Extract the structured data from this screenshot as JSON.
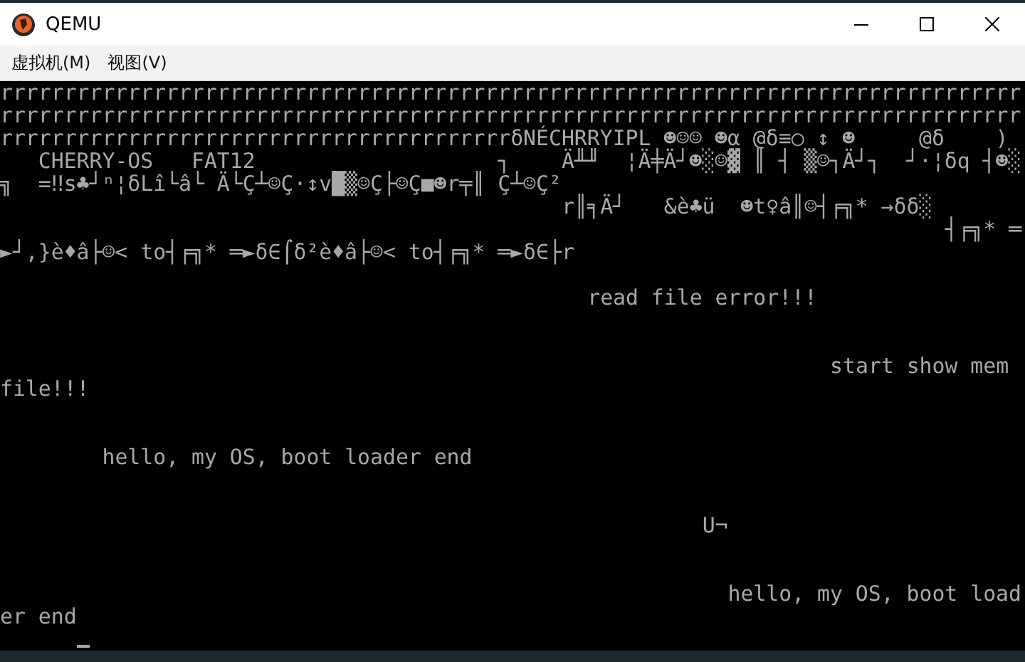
{
  "window": {
    "title": "QEMU"
  },
  "menu": [
    {
      "label": "虚拟机(M)"
    },
    {
      "label": "视图(V)"
    }
  ],
  "console": {
    "lines": [
      {
        "kind": "text",
        "text": "rrrrrrrrrrrrrrrrrrrrrrrrrrrrrrrrrrrrrrrrrrrrrrrrrrrrrrrrrrrrrrrrrrrrrrrrrrrrrrrr"
      },
      {
        "kind": "text",
        "text": "rrrrrrrrrrrrrrrrrrrrrrrrrrrrrrrrrrrrrrrrrrrrrrrrrrrrrrrrrrrrrrrrrrrrrrrrrrrrrrrr"
      },
      {
        "kind": "text",
        "text": "rrrrrrrrrrrrrrrrrrrrrrrrrrrrrrrrrrrrrrrrδNÉCHRRYIPL ☻☺☺ ☻α @δ≡○ ↕ ☻     @δ    )"
      },
      {
        "kind": "text",
        "text": "   CHERRY-OS   FAT12                   ┐    Ä╨╜  ¦Ä╪Ä┘☻░☺▓ ║ ┤ ▒☺┐Ä┘┐  ┘·¦δq ┤☻░"
      },
      {
        "kind": "text",
        "text": "╗  =‼s♣┘ⁿ¦δLî└â└ Ä└Ç┴☺Ç·↕v█▒☺Ç├☺Ç■☻r╤║ Ç┴☺Ç²"
      },
      {
        "kind": "text",
        "text": "                                            r║╕Ä┘   &è♣ü  ☻t♀â║☺┤╒╗* →δδ░"
      },
      {
        "kind": "text",
        "text": "                                                                          ┤╒╗* ═"
      },
      {
        "kind": "text",
        "text": "►┘,}è♦â├☺< to┤╒╗* ═►δ∈⌠δ²è♦â├☺< to┤╒╗* ═►δ∈├r"
      },
      {
        "kind": "blank"
      },
      {
        "kind": "text",
        "text": "                                              read file error!!!"
      },
      {
        "kind": "blank"
      },
      {
        "kind": "blank"
      },
      {
        "kind": "text",
        "text": "                                                                 start show mem"
      },
      {
        "kind": "text",
        "text": "file!!!"
      },
      {
        "kind": "blank"
      },
      {
        "kind": "blank"
      },
      {
        "kind": "text",
        "text": "        hello, my OS, boot loader end"
      },
      {
        "kind": "blank"
      },
      {
        "kind": "blank"
      },
      {
        "kind": "text",
        "text": "                                                       U¬"
      },
      {
        "kind": "blank"
      },
      {
        "kind": "blank"
      },
      {
        "kind": "text",
        "text": "                                                         hello, my OS, boot load"
      },
      {
        "kind": "text",
        "text": "er end"
      },
      {
        "kind": "cursor"
      }
    ]
  }
}
